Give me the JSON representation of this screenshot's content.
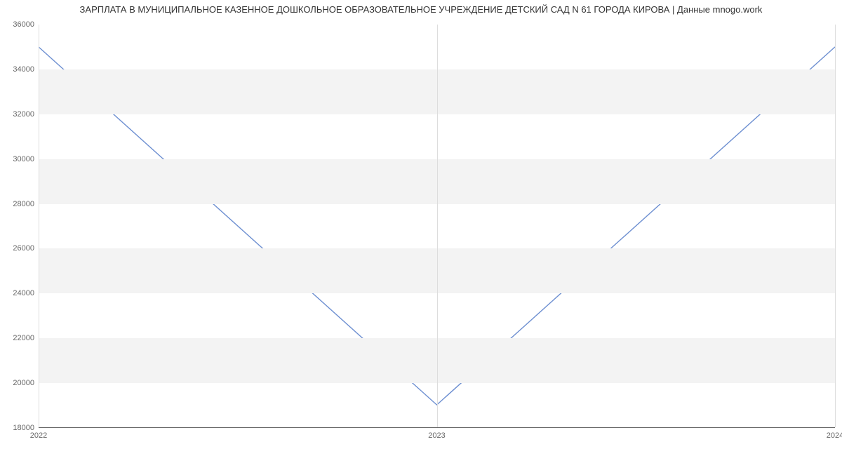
{
  "chart_data": {
    "type": "line",
    "title": "ЗАРПЛАТА В МУНИЦИПАЛЬНОЕ КАЗЕННОЕ ДОШКОЛЬНОЕ ОБРАЗОВАТЕЛЬНОЕ УЧРЕЖДЕНИЕ ДЕТСКИЙ САД N 61 ГОРОДА КИРОВА | Данные mnogo.work",
    "x": [
      2022,
      2023,
      2024
    ],
    "values": [
      35000,
      19000,
      35000
    ],
    "x_ticks": [
      2022,
      2023,
      2024
    ],
    "x_tick_labels": [
      "2022",
      "2023",
      "2024"
    ],
    "y_ticks": [
      18000,
      20000,
      22000,
      24000,
      26000,
      28000,
      30000,
      32000,
      34000,
      36000
    ],
    "y_tick_labels": [
      "18000",
      "20000",
      "22000",
      "24000",
      "26000",
      "28000",
      "30000",
      "32000",
      "34000",
      "36000"
    ],
    "xlim": [
      2022,
      2024
    ],
    "ylim": [
      18000,
      36000
    ],
    "line_color": "#6d8fd1",
    "band_color": "#f3f3f3"
  }
}
